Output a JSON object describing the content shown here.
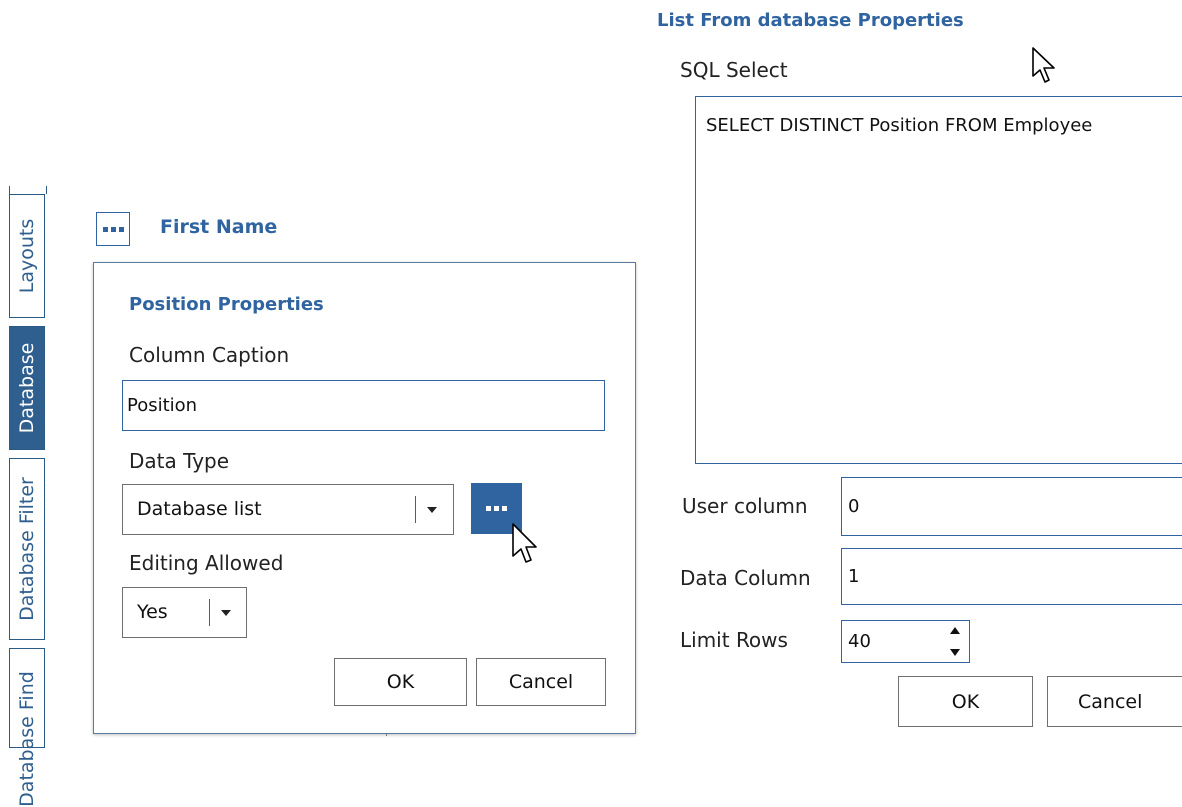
{
  "side_tabs": {
    "layouts": "Layouts",
    "database": "Database",
    "database_filter": "Database Filter",
    "database_find": "Database Find"
  },
  "column_header": {
    "title": "First Name"
  },
  "position_dialog": {
    "title": "Position Properties",
    "column_caption_label": "Column Caption",
    "column_caption_value": "Position",
    "data_type_label": "Data Type",
    "data_type_value": "Database list",
    "editing_allowed_label": "Editing Allowed",
    "editing_allowed_value": "Yes",
    "ok": "OK",
    "cancel": "Cancel"
  },
  "db_list_panel": {
    "title": "List From database Properties",
    "sql_select_label": "SQL Select",
    "sql_select_value": "SELECT DISTINCT Position FROM Employee",
    "user_column_label": "User column",
    "user_column_value": "0",
    "data_column_label": "Data Column",
    "data_column_value": "1",
    "limit_rows_label": "Limit Rows",
    "limit_rows_value": "40",
    "ok": "OK",
    "cancel": "Cancel"
  },
  "colors": {
    "accent": "#2f5f8f",
    "title_blue": "#2f64a0"
  }
}
